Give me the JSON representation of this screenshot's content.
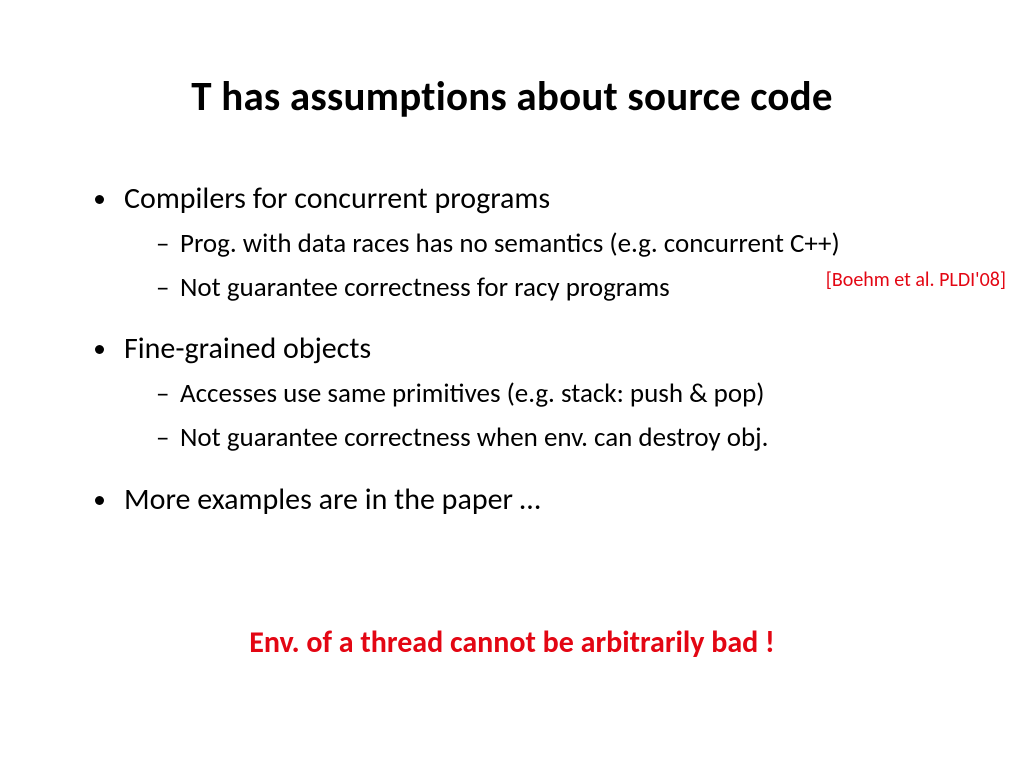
{
  "title": "T has assumptions about source code",
  "bullets": {
    "b1": "Compilers for concurrent programs",
    "b1a": "Prog. with data races has no semantics (e.g. concurrent C++)",
    "b1b": "Not guarantee correctness for racy programs",
    "b2": "Fine-grained objects",
    "b2a": "Accesses use same primitives (e.g. stack: push & pop)",
    "b2b": "Not guarantee correctness when env. can destroy obj.",
    "b3": "More examples are in the paper …"
  },
  "citation": "[Boehm et al. PLDI'08]",
  "callout": "Env. of a thread cannot be arbitrarily bad !"
}
